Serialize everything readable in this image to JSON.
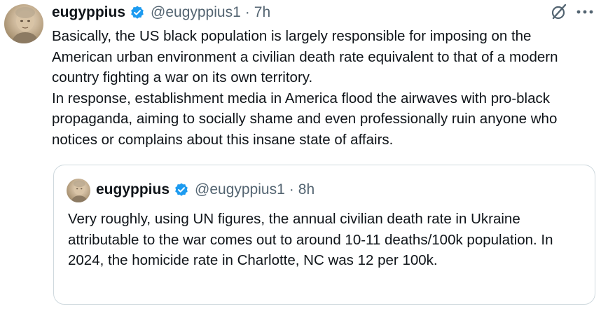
{
  "tweet": {
    "author_name": "eugyppius",
    "handle": "@eugyppius1",
    "separator": "·",
    "time": "7h",
    "text": "Basically, the US black population is largely responsible for imposing on the American urban environment a civilian death rate equivalent to that of a modern country fighting a war on its own territory.\nIn response, establishment media in America flood the airwaves with pro-black propaganda, aiming to socially shame and even professionally ruin anyone who notices or complains about this insane state of affairs.",
    "icons": {
      "verified": "verified-badge-icon",
      "grok": "grok-icon",
      "more": "more-icon"
    }
  },
  "quoted_tweet": {
    "author_name": "eugyppius",
    "handle": "@eugyppius1",
    "separator": "·",
    "time": "8h",
    "text": "Very roughly, using UN figures, the annual civilian death rate in Ukraine attributable to the war comes out to around 10-11 deaths/100k population. In 2024, the homicide rate in Charlotte, NC was 12 per 100k."
  },
  "colors": {
    "text_primary": "#0f1419",
    "text_secondary": "#536471",
    "verified_blue": "#1d9bf0",
    "border": "#cfd9de"
  }
}
